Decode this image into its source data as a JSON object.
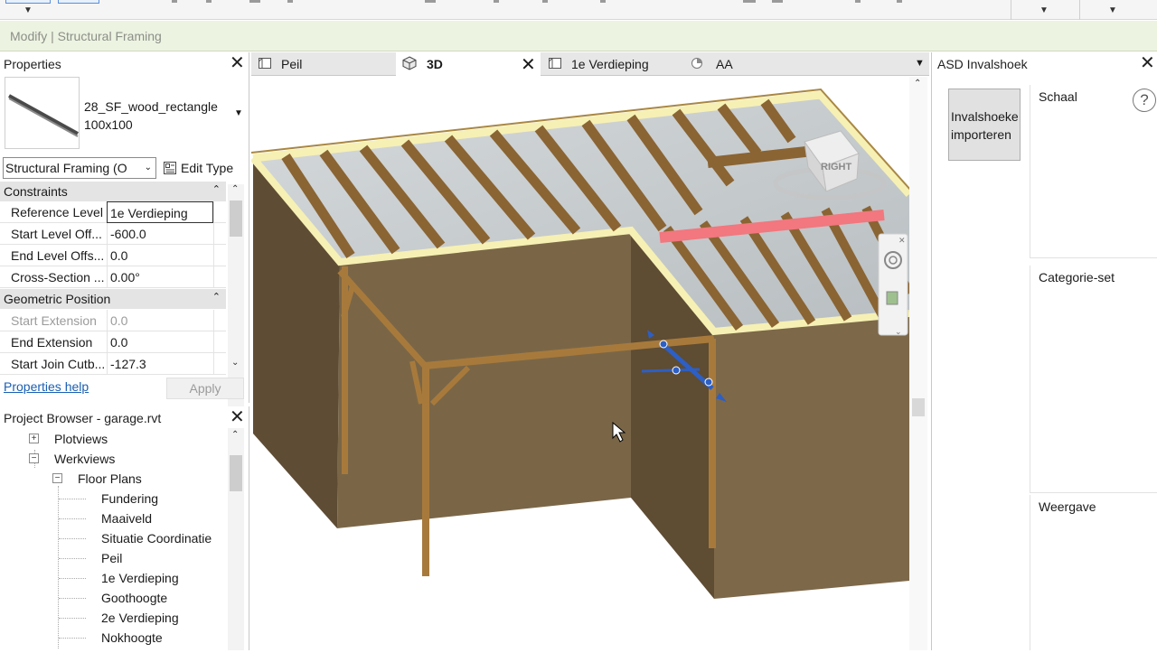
{
  "context_bar": {
    "label": "Modify | Structural Framing"
  },
  "properties": {
    "title": "Properties",
    "type_name_line1": "28_SF_wood_rectangle",
    "type_name_line2": "100x100",
    "category_select": "Structural Framing (O",
    "edit_type": "Edit Type",
    "sections": {
      "constraints": "Constraints",
      "geometric_position": "Geometric Position"
    },
    "rows": [
      {
        "name": "Reference Level",
        "value": "1e Verdieping"
      },
      {
        "name": "Start Level Off...",
        "value": "-600.0"
      },
      {
        "name": "End Level Offs...",
        "value": "0.0"
      },
      {
        "name": "Cross-Section ...",
        "value": "0.00°"
      },
      {
        "name": "Start Extension",
        "value": "0.0"
      },
      {
        "name": "End Extension",
        "value": "0.0"
      },
      {
        "name": "Start Join Cutb...",
        "value": "-127.3"
      }
    ],
    "help_link": "Properties help",
    "apply": "Apply"
  },
  "project_browser": {
    "title": "Project Browser - garage.rvt",
    "items": [
      {
        "label": "Plotviews",
        "level": 0,
        "toggle": "+"
      },
      {
        "label": "Werkviews",
        "level": 0,
        "toggle": "−"
      },
      {
        "label": "Floor Plans",
        "level": 1,
        "toggle": "−"
      },
      {
        "label": "Fundering",
        "level": 2
      },
      {
        "label": "Maaiveld",
        "level": 2
      },
      {
        "label": "Situatie Coordinatie",
        "level": 2
      },
      {
        "label": "Peil",
        "level": 2
      },
      {
        "label": "1e Verdieping",
        "level": 2
      },
      {
        "label": "Goothoogte",
        "level": 2
      },
      {
        "label": "2e Verdieping",
        "level": 2
      },
      {
        "label": "Nokhoogte",
        "level": 2
      }
    ]
  },
  "view_tabs": [
    {
      "label": "Peil",
      "active": false
    },
    {
      "label": "3D",
      "active": true
    },
    {
      "label": "1e Verdieping",
      "active": false
    },
    {
      "label": "AA",
      "active": false
    }
  ],
  "viewcube": {
    "face": "RIGHT"
  },
  "asd_panel": {
    "title": "ASD Invalshoek",
    "button_line1": "Invalshoeke",
    "button_line2": "importeren",
    "sections": [
      "Schaal",
      "Categorie-set",
      "Weergave"
    ],
    "help": "?"
  },
  "colors": {
    "wall": "#7a6647",
    "wall_dark": "#5e4c33",
    "timber": "#a77a3c",
    "floor": "#c9cfd1",
    "beam_highlight": "#f2777e",
    "rim": "#f6f0b4",
    "context_bar": "#edf3e1",
    "selection_blue": "#2d5fc4"
  }
}
